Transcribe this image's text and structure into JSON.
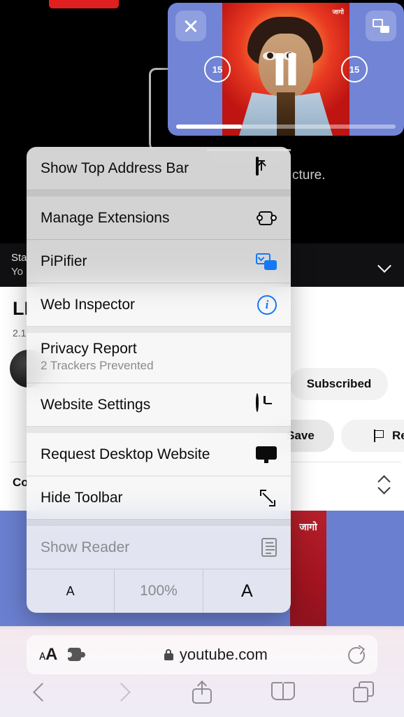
{
  "page": {
    "site": "youtube.com",
    "video_overlay_text": "cture.",
    "dark_bar": {
      "line1": "Sta",
      "line2": "Yo",
      "chevron_icon": "chevron-down-icon"
    },
    "video_title": "LI",
    "view_count": "2.1",
    "comments_label": "Co",
    "buttons": {
      "subscribed": "Subscribed",
      "save": "Save",
      "report": "Rep"
    },
    "thumbnail_caption": "जागो",
    "thumbnail_blue": "#6b7fd0",
    "thumbnail_red": "#b41f2a"
  },
  "pip": {
    "close_label": "close-icon",
    "restore_label": "pip-restore-icon",
    "skip_back": "15",
    "skip_forward": "15",
    "state": "paused",
    "progress_percent": 30,
    "watermark": "जागो"
  },
  "menu": {
    "items": [
      {
        "label": "Show Top Address Bar",
        "icon": "address-bar-icon",
        "disabled": false
      },
      {
        "label": "Manage Extensions",
        "icon": "puzzle-icon",
        "disabled": false
      },
      {
        "label": "PiPifier",
        "icon": "picture-in-picture-icon",
        "disabled": false
      },
      {
        "label": "Web Inspector",
        "icon": "info-circle-icon",
        "disabled": false
      },
      {
        "label": "Privacy Report",
        "sublabel": "2 Trackers Prevented",
        "icon": "shield-icon",
        "disabled": false
      },
      {
        "label": "Website Settings",
        "icon": "gear-icon",
        "disabled": false
      },
      {
        "label": "Request Desktop Website",
        "icon": "desktop-icon",
        "disabled": false
      },
      {
        "label": "Hide Toolbar",
        "icon": "expand-arrows-icon",
        "disabled": false
      },
      {
        "label": "Show Reader",
        "icon": "reader-icon",
        "disabled": true
      }
    ],
    "zoom_row": {
      "decrease": "A",
      "level": "100%",
      "increase": "A"
    }
  },
  "address_bar": {
    "text_size_label": "ᴀA",
    "extensions_icon": "extensions-puzzle-icon",
    "lock_icon": "lock-icon",
    "url": "youtube.com",
    "reload_icon": "reload-icon"
  },
  "toolbar": {
    "back": "back-chevron-icon",
    "forward": "forward-chevron-icon",
    "share": "share-icon",
    "bookmarks": "bookmarks-icon",
    "tabs": "tabs-icon"
  },
  "colors": {
    "accent_blue": "#1578f5",
    "youtube_red": "#e02020",
    "disabled_gray": "#8a8a8e"
  }
}
